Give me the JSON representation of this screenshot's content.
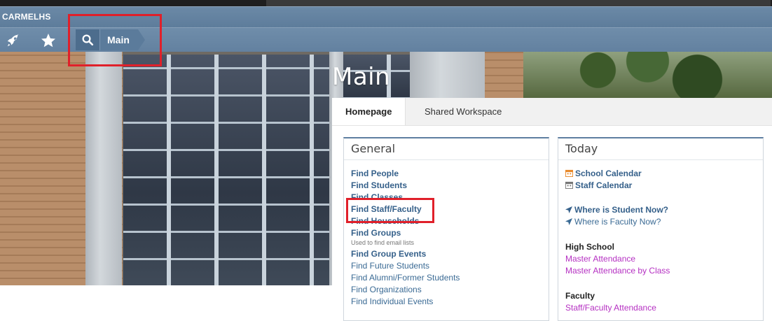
{
  "header": {
    "site_name": "CARMELHS"
  },
  "nav": {
    "launch_icon": "rocket-icon",
    "favorites_icon": "star-icon",
    "search_icon": "search-icon",
    "breadcrumb_current": "Main"
  },
  "page": {
    "title": "Main"
  },
  "tabs": [
    {
      "label": "Homepage",
      "active": true
    },
    {
      "label": "Shared Workspace",
      "active": false
    }
  ],
  "general": {
    "title": "General",
    "links": [
      {
        "label": "Find People",
        "bold": true
      },
      {
        "label": "Find Students",
        "bold": true
      },
      {
        "label": "Find Classes",
        "bold": true
      },
      {
        "label": "Find Staff/Faculty",
        "bold": true
      },
      {
        "label": "Find Households",
        "bold": true
      },
      {
        "label": "Find Groups",
        "bold": true
      },
      {
        "label": "Find Group Events",
        "bold": true
      },
      {
        "label": "Find Future Students",
        "bold": false
      },
      {
        "label": "Find Alumni/Former Students",
        "bold": false
      },
      {
        "label": "Find Organizations",
        "bold": false
      },
      {
        "label": "Find Individual Events",
        "bold": false
      }
    ],
    "groups_note": "Used to find email lists"
  },
  "today": {
    "title": "Today",
    "school_calendar": "School Calendar",
    "staff_calendar": "Staff Calendar",
    "where_student": "Where is Student Now?",
    "where_faculty": "Where is Faculty Now?",
    "high_school": {
      "heading": "High School",
      "links": [
        "Master Attendance",
        "Master Attendance by Class"
      ]
    },
    "faculty": {
      "heading": "Faculty",
      "links": [
        "Staff/Faculty Attendance"
      ]
    }
  },
  "colors": {
    "nav_blue": "#6381a0",
    "link_blue": "#35608a",
    "highlight_red": "#e0202a",
    "calendar_orange": "#e8892b",
    "magenta_link": "#b530c2"
  }
}
